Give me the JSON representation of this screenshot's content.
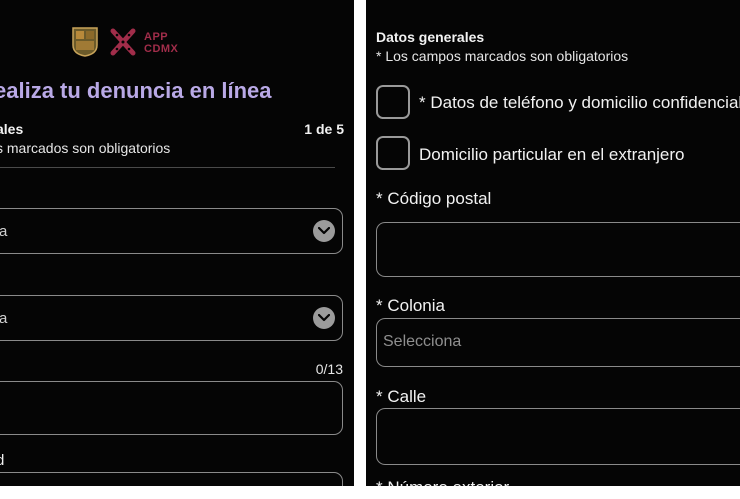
{
  "left": {
    "headline": "ealiza tu denuncia en línea",
    "section_title": "ales",
    "step_counter": "1 de 5",
    "required_note": "s marcados son obligatorios",
    "select_1_value": "a",
    "select_2_value": "a",
    "char_count": "0/13",
    "cut_label": "d"
  },
  "logo": {
    "line1": "APP",
    "line2": "CDMX",
    "brand_color": "#a12d4a"
  },
  "right": {
    "title": "Datos generales",
    "required_note": "* Los campos marcados son obligatorios",
    "checkbox_1_label": "* Datos de teléfono y domicilio confidenciales",
    "checkbox_2_label": "Domicilio particular en el extranjero",
    "postal_code_label": "* Código postal",
    "colonia_label": "* Colonia",
    "colonia_placeholder": "Selecciona",
    "calle_label": "* Calle",
    "next_label": "* Número exterior"
  },
  "colors": {
    "background": "#050505",
    "headline": "#b9a9e6",
    "border": "#8a8a8a"
  }
}
